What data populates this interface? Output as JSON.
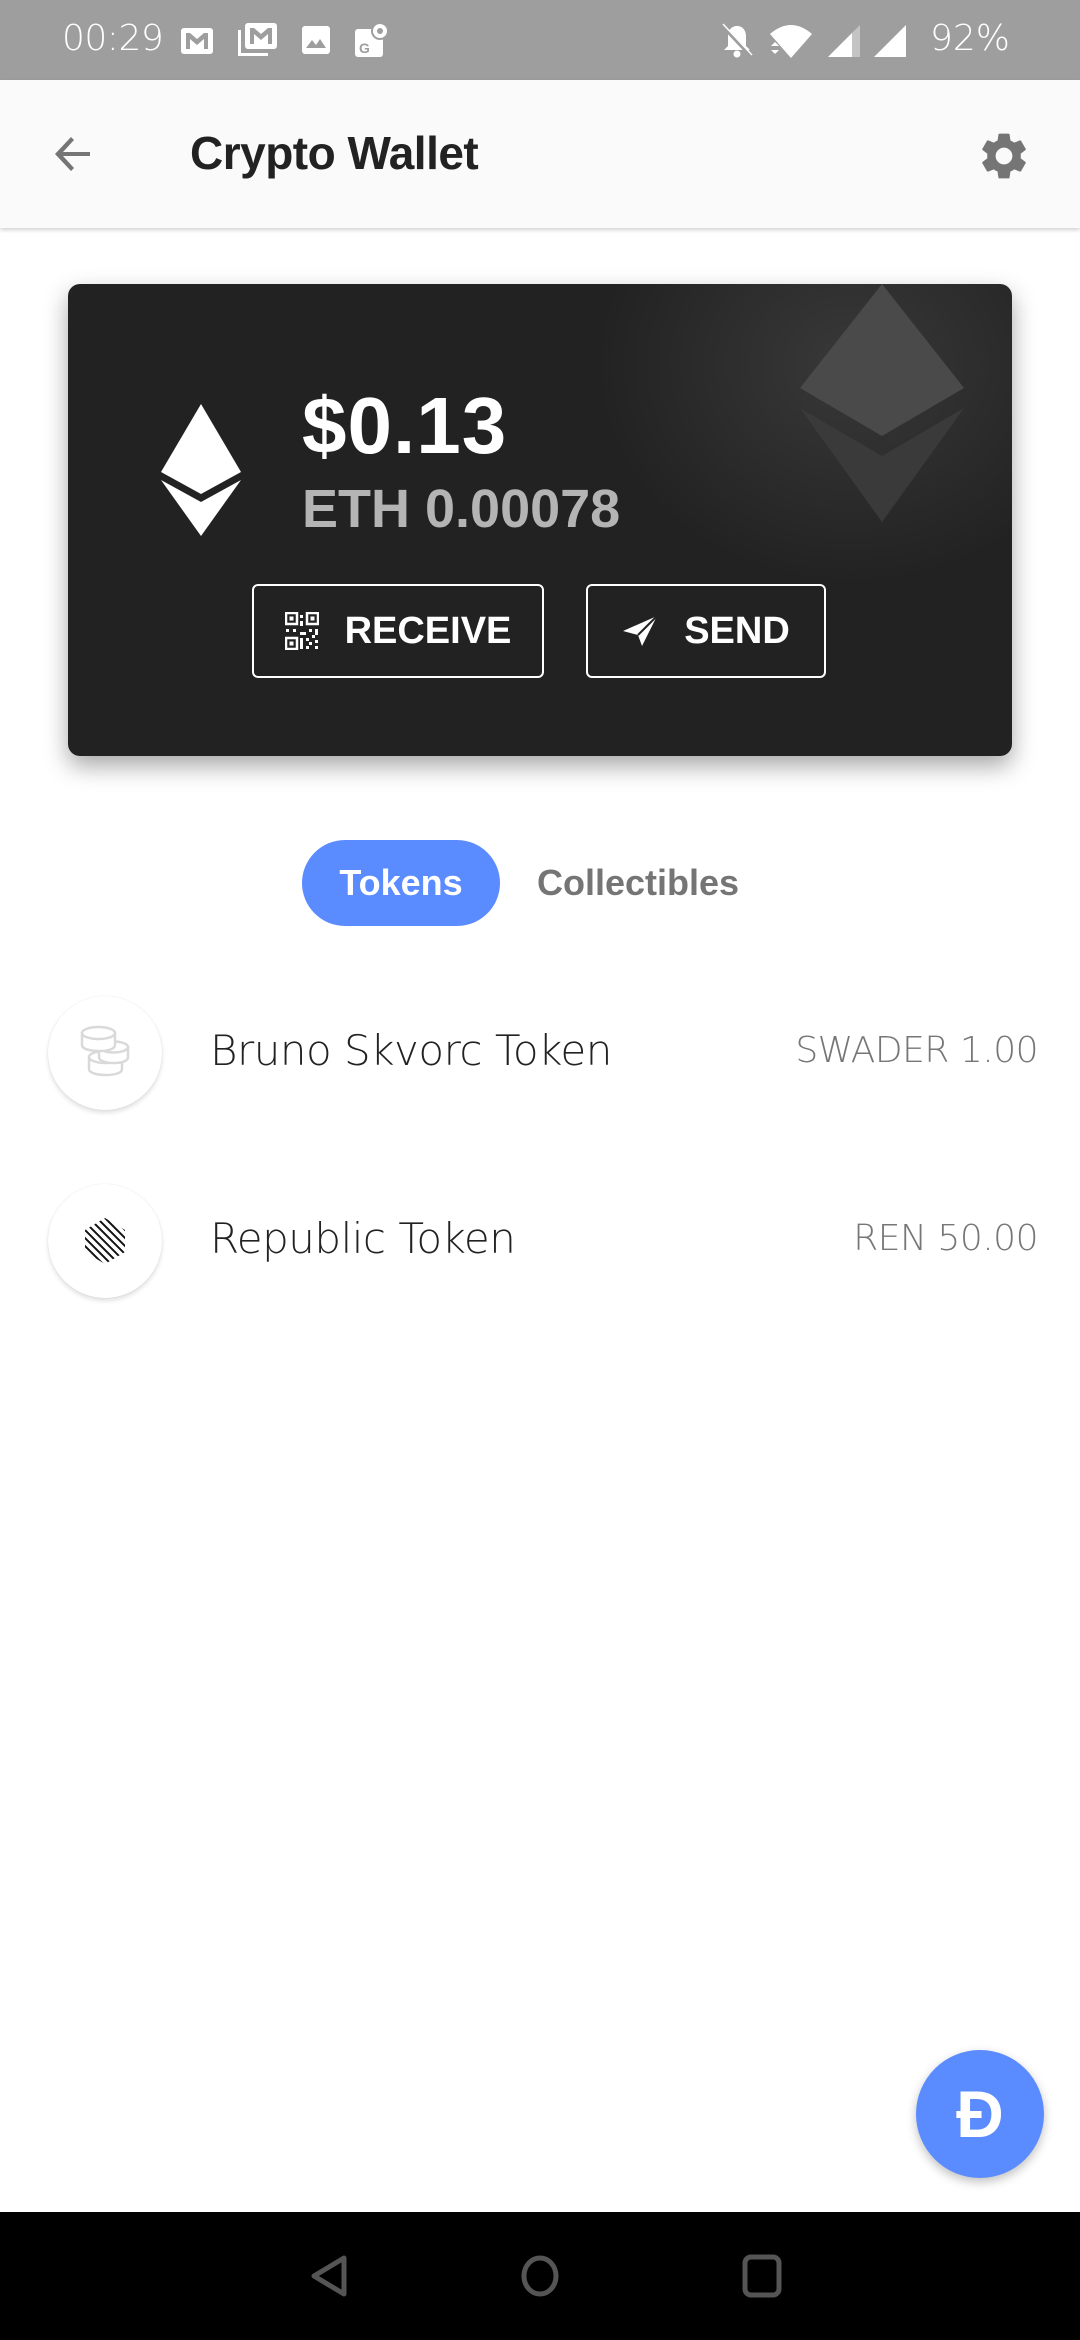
{
  "status_bar": {
    "time": "00:29",
    "battery": "92%",
    "left_icons": [
      "gmail-icon",
      "gmail-multiple-icon",
      "image-icon",
      "google-maps-icon"
    ],
    "right_icons": [
      "notifications-off-icon",
      "wifi-icon",
      "cellular-signal-1-icon",
      "cellular-signal-2-icon"
    ]
  },
  "app_bar": {
    "title": "Crypto Wallet",
    "back_icon": "arrow-back-icon",
    "settings_icon": "gear-icon"
  },
  "wallet_card": {
    "balance_usd": "$0.13",
    "balance_eth": "ETH 0.00078",
    "receive_label": "RECEIVE",
    "send_label": "SEND",
    "receive_icon": "qr-code-icon",
    "send_icon": "paper-plane-icon"
  },
  "tabs": [
    {
      "label": "Tokens",
      "active": true
    },
    {
      "label": "Collectibles",
      "active": false
    }
  ],
  "tokens": [
    {
      "name": "Bruno Skvorc Token",
      "balance": "SWADER 1.00",
      "icon": "coins-icon"
    },
    {
      "name": "Republic Token",
      "balance": "REN 50.00",
      "icon": "republic-token-icon"
    }
  ],
  "fab": {
    "label": "Ð",
    "icon": "dapp-browser-icon"
  },
  "colors": {
    "accent": "#5a8bff",
    "card_bg": "#222222",
    "status_bar": "#9e9e9e"
  },
  "nav_bar": [
    "back-icon",
    "home-icon",
    "recents-icon"
  ]
}
